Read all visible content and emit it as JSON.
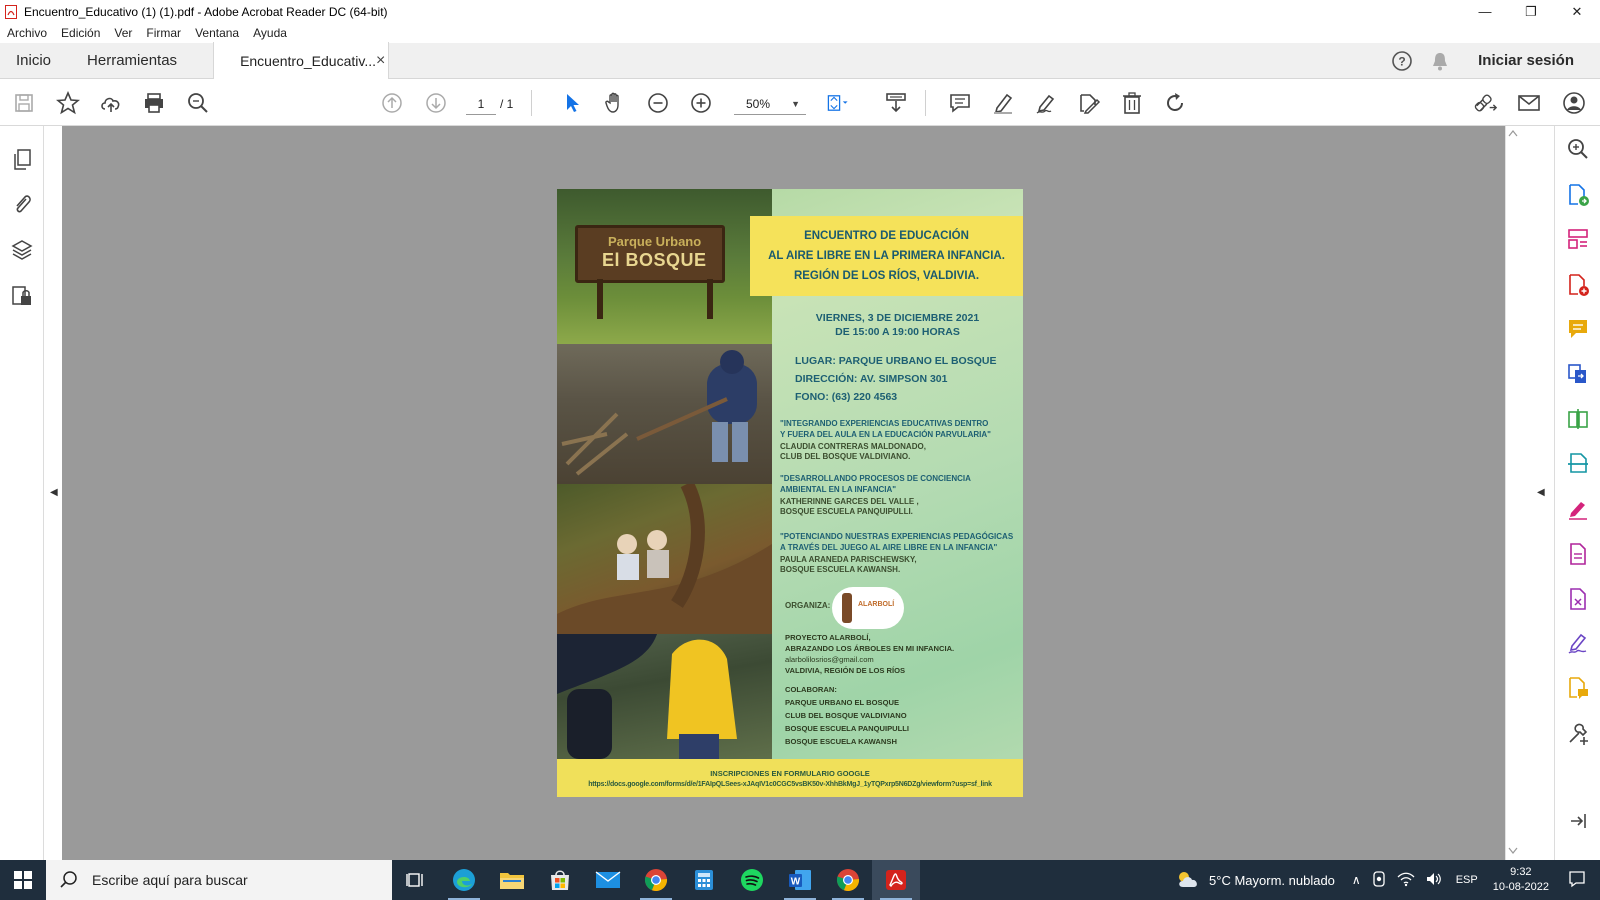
{
  "window": {
    "title": "Encuentro_Educativo (1) (1).pdf - Adobe Acrobat Reader DC (64-bit)",
    "minimize": "—",
    "restore": "❐",
    "close": "✕"
  },
  "menu": [
    "Archivo",
    "Edición",
    "Ver",
    "Firmar",
    "Ventana",
    "Ayuda"
  ],
  "tabs": {
    "home": "Inicio",
    "tools": "Herramientas",
    "document": "Encuentro_Educativ...",
    "close": "×",
    "signin": "Iniciar sesión"
  },
  "toolbar": {
    "page_current": "1",
    "page_total": "/ 1",
    "zoom": "50%"
  },
  "poster": {
    "sign_line1": "Parque Urbano",
    "sign_line2": "El BOSQUE",
    "heading": [
      "ENCUENTRO DE EDUCACIÓN",
      "AL AIRE LIBRE EN LA PRIMERA INFANCIA.",
      "REGIÓN DE LOS RÍOS, VALDIVIA."
    ],
    "date": "VIERNES, 3 DE DICIEMBRE 2021",
    "time": "DE 15:00 A 19:00 HORAS",
    "place": "LUGAR: PARQUE URBANO EL BOSQUE",
    "address": "DIRECCIÓN: AV. SIMPSON 301",
    "phone": "FONO: (63) 220 4563",
    "talks": [
      {
        "title1": "\"INTEGRANDO EXPERIENCIAS EDUCATIVAS DENTRO",
        "title2": "Y FUERA DEL AULA EN LA EDUCACIÓN PARVULARIA\"",
        "speaker1": "CLAUDIA CONTRERAS MALDONADO,",
        "speaker2": "CLUB DEL BOSQUE VALDIVIANO."
      },
      {
        "title1": "\"DESARROLLANDO PROCESOS DE CONCIENCIA",
        "title2": "AMBIENTAL EN LA INFANCIA\"",
        "speaker1": "KATHERINNE GARCES DEL VALLE ,",
        "speaker2": "BOSQUE ESCUELA PANQUIPULLI."
      },
      {
        "title1": "\"POTENCIANDO NUESTRAS EXPERIENCIAS PEDAGÓGICAS",
        "title2": "A TRAVÉS DEL JUEGO AL AIRE LIBRE EN LA INFANCIA\"",
        "speaker1": "PAULA ARANEDA PARISCHEWSKY,",
        "speaker2": "BOSQUE ESCUELA KAWANSH."
      }
    ],
    "organiza": "ORGANIZA:",
    "logo_text": "ALARBOLÍ",
    "org_lines": [
      "PROYECTO ALARBOLÍ,",
      "ABRAZANDO LOS ÁRBOLES EN MI INFANCIA.",
      "alarbolilosrios@gmail.com",
      "VALDIVIA, REGIÓN DE LOS RÍOS"
    ],
    "colaboran_label": "COLABORAN:",
    "colaboran": [
      "PARQUE URBANO EL BOSQUE",
      "CLUB DEL BOSQUE VALDIVIANO",
      "BOSQUE ESCUELA PANQUIPULLI",
      "BOSQUE ESCUELA KAWANSH"
    ],
    "signup": "INSCRIPCIONES EN FORMULARIO GOOGLE",
    "signup_url": "https://docs.google.com/forms/d/e/1FAIpQLSees-xJAqIV1c0CGC5vsBK50v-XhhBkMgJ_1yTQPxrp5N6DZg/viewform?usp=sf_link"
  },
  "taskbar": {
    "search_placeholder": "Escribe aquí para buscar",
    "weather": "5°C  Mayorm. nublado",
    "lang": "ESP",
    "time": "9:32",
    "date": "10-08-2022"
  },
  "colors": {
    "acrobat_red": "#d4231c",
    "taskbar_bg": "#1f2e3d",
    "toolbar_blue": "#1473e6",
    "right_panel_icons": [
      "#1473e6",
      "#d4237b",
      "#d4231c",
      "#e8a90c",
      "#2a57c9",
      "#3aa347",
      "#1496a4",
      "#d4237b",
      "#b0259b",
      "#9c2fb0",
      "#6a45c4",
      "#e8a90c",
      "#444444"
    ]
  }
}
